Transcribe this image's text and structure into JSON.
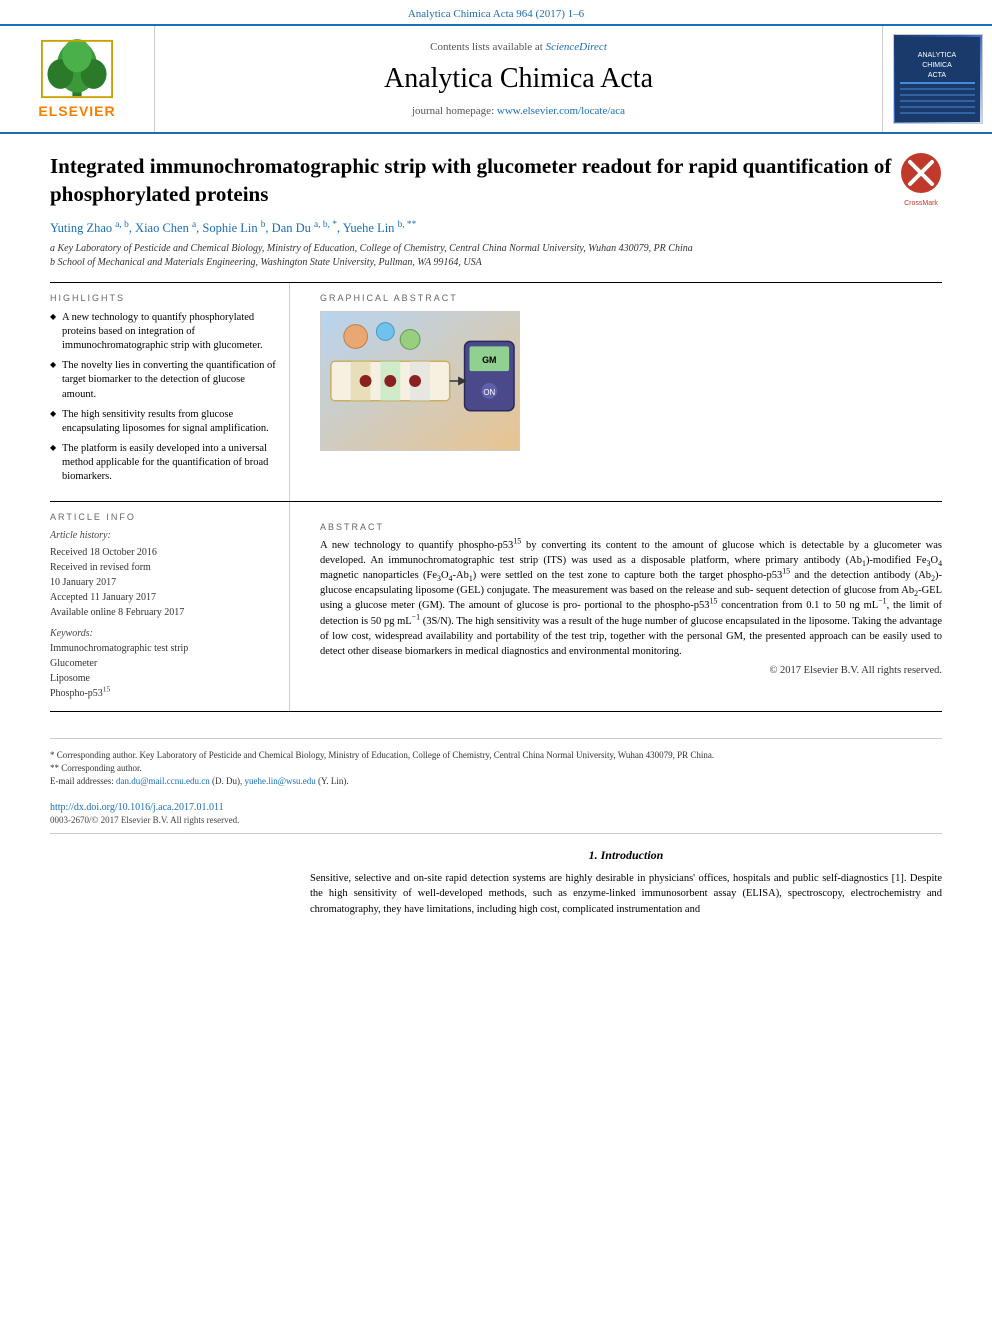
{
  "journal": {
    "top_ref": "Analytica Chimica Acta 964 (2017) 1–6",
    "sciencedirect_text": "Contents lists available at",
    "sciencedirect_link": "ScienceDirect",
    "title": "Analytica Chimica Acta",
    "homepage_text": "journal homepage:",
    "homepage_link": "www.elsevier.com/locate/aca",
    "elsevier_label": "ELSEVIER"
  },
  "article": {
    "title": "Integrated immunochromatographic strip with glucometer readout for rapid quantification of phosphorylated proteins",
    "authors": "Yuting Zhao a, b, Xiao Chen a, Sophie Lin b, Dan Du a, b, *, Yuehe Lin b, **",
    "affiliation_a": "a Key Laboratory of Pesticide and Chemical Biology, Ministry of Education, College of Chemistry, Central China Normal University, Wuhan 430079, PR China",
    "affiliation_b": "b School of Mechanical and Materials Engineering, Washington State University, Pullman, WA 99164, USA"
  },
  "highlights": {
    "heading": "HIGHLIGHTS",
    "items": [
      "A new technology to quantify phosphorylated proteins based on integration of immunochromatographic strip with glucometer.",
      "The novelty lies in converting the quantification of target biomarker to the detection of glucose amount.",
      "The high sensitivity results from glucose encapsulating liposomes for signal amplification.",
      "The platform is easily developed into a universal method applicable for the quantification of broad biomarkers."
    ]
  },
  "graphical_abstract": {
    "heading": "GRAPHICAL ABSTRACT"
  },
  "article_info": {
    "heading": "ARTICLE INFO",
    "history_title": "Article history:",
    "received": "Received 18 October 2016",
    "received_revised": "Received in revised form",
    "received_revised_date": "10 January 2017",
    "accepted": "Accepted 11 January 2017",
    "available": "Available online 8 February 2017",
    "keywords_title": "Keywords:",
    "keywords": [
      "Immunochromatographic test strip",
      "Glucometer",
      "Liposome",
      "Phospho-p53¹⁵"
    ]
  },
  "abstract": {
    "heading": "ABSTRACT",
    "text": "A new technology to quantify phospho-p53¹⁵ by converting its content to the amount of glucose which is detectable by a glucometer was developed. An immunochromatographic test strip (ITS) was used as a disposable platform, where primary antibody (Ab₁)-modified Fe₃O₄ magnetic nanoparticles (Fe₃O₄-Ab₁) were settled on the test zone to capture both the target phospho-p53¹⁵ and the detection antibody (Ab₂)-glucose encapsulating liposome (GEL) conjugate. The measurement was based on the release and subsequent detection of glucose from Ab₂-GEL using a glucose meter (GM). The amount of glucose is proportional to the phospho-p53¹⁵ concentration from 0.1 to 50 ng mL⁻¹, the limit of detection is 50 pg mL⁻¹ (3S/N). The high sensitivity was a result of the huge number of glucose encapsulated in the liposome. Taking the advantage of low cost, widespread availability and portability of the test trip, together with the personal GM, the presented approach can be easily used to detect other disease biomarkers in medical diagnostics and environmental monitoring.",
    "copyright": "© 2017 Elsevier B.V. All rights reserved."
  },
  "footnotes": {
    "corresponding_star": "* Corresponding author. Key Laboratory of Pesticide and Chemical Biology, Ministry of Education, College of Chemistry, Central China Normal University, Wuhan 430079, PR China.",
    "corresponding_double_star": "** Corresponding author.",
    "email_label": "E-mail addresses:",
    "email_dan": "dan.du@mail.ccnu.edu.cn",
    "email_dan_name": "(D. Du),",
    "email_yuehe": "yuehe.lin@wsu.edu",
    "email_yuehe_name": "(Y. Lin)."
  },
  "doi": {
    "link": "http://dx.doi.org/10.1016/j.aca.2017.01.011",
    "issn": "0003-2670/© 2017 Elsevier B.V. All rights reserved."
  },
  "introduction": {
    "section_num": "1.",
    "section_title": "Introduction",
    "text": "Sensitive, selective and on-site rapid detection systems are highly desirable in physicians' offices, hospitals and public self-diagnostics [1]. Despite the high sensitivity of well-developed methods, such as enzyme-linked immunosorbent assay (ELISA), spectroscopy, electrochemistry and chromatography, they have limitations, including high cost, complicated instrumentation and"
  }
}
